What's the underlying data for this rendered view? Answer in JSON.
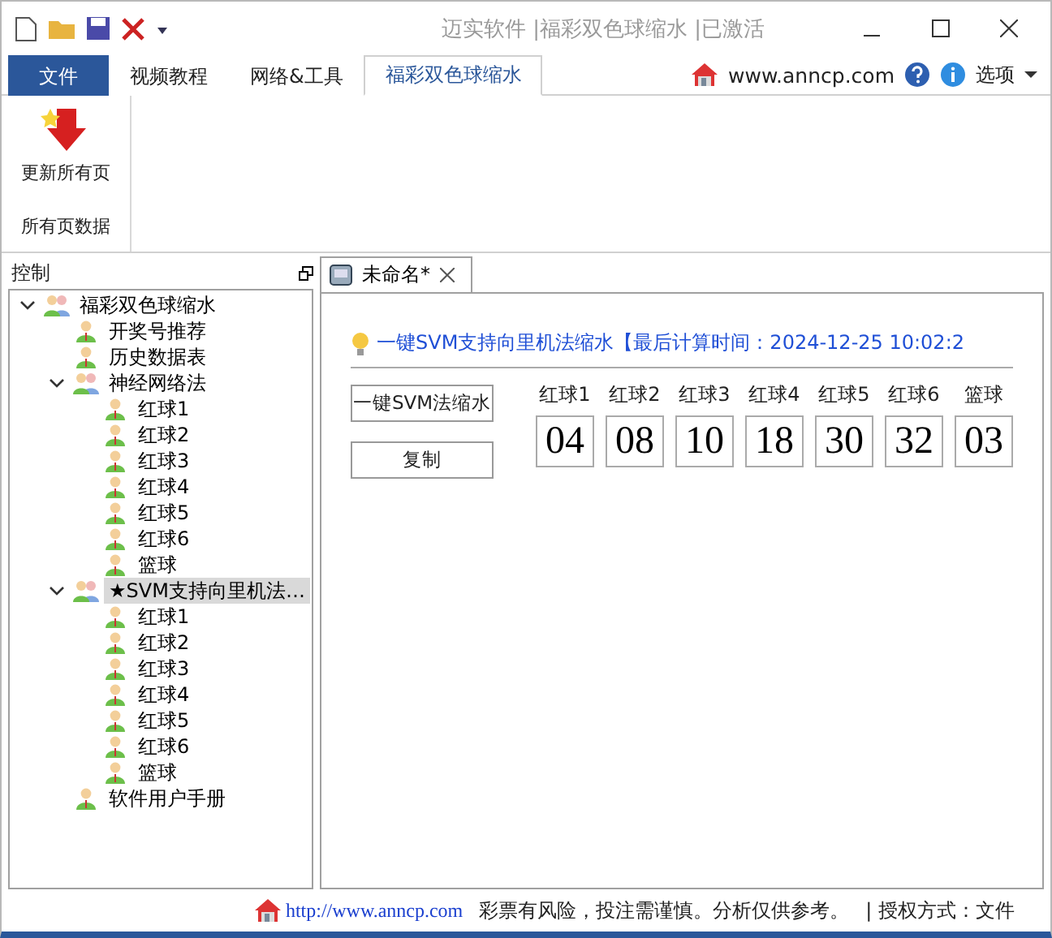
{
  "window": {
    "title": "迈实软件 |福彩双色球缩水 |已激活"
  },
  "ribbon_tabs": [
    {
      "label": "文件",
      "kind": "file",
      "selected": false
    },
    {
      "label": "视频教程",
      "kind": "tab",
      "selected": false
    },
    {
      "label": "网络&工具",
      "kind": "tab",
      "selected": false
    },
    {
      "label": "福彩双色球缩水",
      "kind": "tab",
      "selected": true
    }
  ],
  "ribbon_right": {
    "link": "www.anncp.com",
    "options": "选项"
  },
  "ribbon": {
    "button": "更新所有页",
    "group": "所有页数据"
  },
  "sidebar": {
    "title": "控制",
    "items": [
      {
        "label": "福彩双色球缩水",
        "kind": "group",
        "expanded": true,
        "selected": false,
        "children": [
          {
            "label": "开奖号推荐",
            "kind": "leaf",
            "selected": false
          },
          {
            "label": "历史数据表",
            "kind": "leaf",
            "selected": false
          },
          {
            "label": "神经网络法",
            "kind": "group",
            "expanded": true,
            "selected": false,
            "children": [
              {
                "label": "红球1",
                "kind": "leaf",
                "selected": false
              },
              {
                "label": "红球2",
                "kind": "leaf",
                "selected": false
              },
              {
                "label": "红球3",
                "kind": "leaf",
                "selected": false
              },
              {
                "label": "红球4",
                "kind": "leaf",
                "selected": false
              },
              {
                "label": "红球5",
                "kind": "leaf",
                "selected": false
              },
              {
                "label": "红球6",
                "kind": "leaf",
                "selected": false
              },
              {
                "label": "篮球",
                "kind": "leaf",
                "selected": false
              }
            ]
          },
          {
            "label": "★SVM支持向里机法…",
            "kind": "group",
            "expanded": true,
            "selected": true,
            "children": [
              {
                "label": "红球1",
                "kind": "leaf",
                "selected": false
              },
              {
                "label": "红球2",
                "kind": "leaf",
                "selected": false
              },
              {
                "label": "红球3",
                "kind": "leaf",
                "selected": false
              },
              {
                "label": "红球4",
                "kind": "leaf",
                "selected": false
              },
              {
                "label": "红球5",
                "kind": "leaf",
                "selected": false
              },
              {
                "label": "红球6",
                "kind": "leaf",
                "selected": false
              },
              {
                "label": "篮球",
                "kind": "leaf",
                "selected": false
              }
            ]
          },
          {
            "label": "软件用户手册",
            "kind": "leaf",
            "selected": false
          }
        ]
      }
    ]
  },
  "document_tabs": [
    {
      "label": "未命名*",
      "selected": true
    }
  ],
  "content": {
    "heading": "一键SVM支持向里机法缩水【最后计算时间：2024-12-25 10:02:2",
    "buttons": [
      "一键SVM法缩水",
      "复制"
    ],
    "balls": [
      {
        "label": "红球1",
        "value": "04"
      },
      {
        "label": "红球2",
        "value": "08"
      },
      {
        "label": "红球3",
        "value": "10"
      },
      {
        "label": "红球4",
        "value": "18"
      },
      {
        "label": "红球5",
        "value": "30"
      },
      {
        "label": "红球6",
        "value": "32"
      },
      {
        "label": "篮球",
        "value": "03"
      }
    ]
  },
  "status_bar": {
    "link": "http://www.anncp.com",
    "notice": "彩票有风险，投注需谨慎。分析仅供参考。",
    "license": "| 授权方式：文件"
  }
}
